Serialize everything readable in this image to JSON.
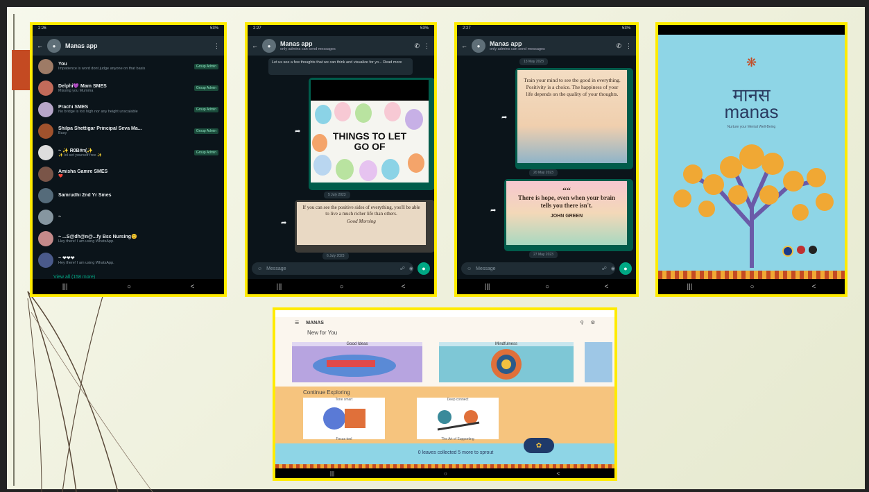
{
  "phone1": {
    "status_time": "2:26",
    "status_right": "53%",
    "title": "Manas app",
    "chats": [
      {
        "name": "You",
        "sub": "Impatience is word dont judge anyone on that basis",
        "badge": "Group Admin",
        "color": "#9e7b66"
      },
      {
        "name": "Delphi💜 Mam SMES",
        "sub": "Missing you Mumma",
        "badge": "Group Admin",
        "color": "#c26b5a"
      },
      {
        "name": "Prachi SMES",
        "sub": "No bridge is too high nor any height unscalable",
        "badge": "Group Admin",
        "color": "#b7a6c9"
      },
      {
        "name": "Shilpa Shettigar Principal Seva Ma...",
        "sub": "Busy",
        "badge": "Group Admin",
        "color": "#a0522d"
      },
      {
        "name": "~ ✨ R0B#n(✨",
        "sub": "✨ lol set yourself free ✨",
        "badge": "Group Admin",
        "color": "#dddddd"
      },
      {
        "name": "Amisha Gamre SMES",
        "sub": "❤️",
        "badge": "",
        "color": "#7a5548"
      },
      {
        "name": "Samrudhi 2nd Yr Smes",
        "sub": "",
        "badge": "",
        "color": "#556b7a"
      },
      {
        "name": "~",
        "sub": "",
        "badge": "",
        "color": "#8696a0"
      },
      {
        "name": "~ ...S@dh@n@...fy Bsc Nursing😊",
        "sub": "Hey there! I am using WhatsApp.",
        "badge": "",
        "color": "#c48a8a"
      },
      {
        "name": "~ ❤❤❤",
        "sub": "Hey there! I am using WhatsApp.",
        "badge": "",
        "color": "#4a5a8a"
      }
    ],
    "view_all": "View all (158 more)"
  },
  "phone2": {
    "status_time": "2:27",
    "status_right": "53%",
    "title": "Manas app",
    "subtitle": "only admins can send messages",
    "top_msg": "Let us see a few thoughts that we can think and visualize for yo... Read more",
    "poster_title": "THINGS TO LET GO OF",
    "date_pill": "5 July 2023",
    "date_pill2": "6 July 2023",
    "quote": "If you can see the positive sides of everything, you'll be able to live a much richer life than others.",
    "quote_sign": "Good Morning",
    "message_placeholder": "Message"
  },
  "phone3": {
    "status_time": "2:27",
    "status_right": "53%",
    "title": "Manas app",
    "subtitle": "only admins can send messages",
    "date_pill1": "13 May 2023",
    "quote1": "Train your mind to see the good in everything. Positivity is a choice. The happiness of your life depends on the quality of your thoughts.",
    "date_pill2": "20 May 2023",
    "quote2": "There is hope, even when your brain tells you there isn't.",
    "quote2_author": "JOHN GREEN",
    "date_pill3": "27 May 2023",
    "message_placeholder": "Message"
  },
  "phone4": {
    "title_hindi": "मानस",
    "title_en": "manas",
    "tagline": "Nurture your Mental Well-Being"
  },
  "phone5": {
    "app_title": "MANAS",
    "section1": "New for You",
    "cards": [
      "Good Ideas",
      "Mindfulness"
    ],
    "section2": "Continue Exploring",
    "cards2": [
      "Tone smart",
      "Deep connect"
    ],
    "cards2_sub": [
      "Focus tool",
      "The Art of Supporting"
    ],
    "footer": "0 leaves collected 5 more to sprout"
  },
  "colors": {
    "frame": "#ffeb00",
    "wa_dark": "#0b141a",
    "wa_green": "#00a884",
    "manas_bg": "#8ed5e6",
    "accent_red": "#c44a22"
  }
}
